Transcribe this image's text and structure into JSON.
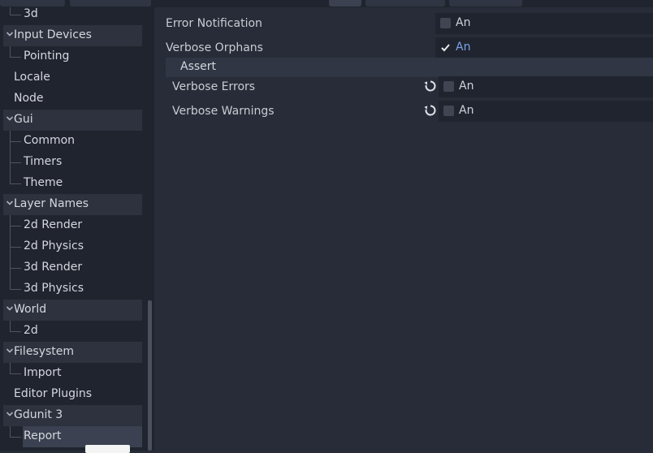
{
  "tree": {
    "items": [
      {
        "label": "3d",
        "kind": "child"
      },
      {
        "label": "Input Devices",
        "kind": "section"
      },
      {
        "label": "Pointing",
        "kind": "child"
      },
      {
        "label": "Locale",
        "kind": "plain"
      },
      {
        "label": "Node",
        "kind": "plain"
      },
      {
        "label": "Gui",
        "kind": "section"
      },
      {
        "label": "Common",
        "kind": "child"
      },
      {
        "label": "Timers",
        "kind": "child"
      },
      {
        "label": "Theme",
        "kind": "child"
      },
      {
        "label": "Layer Names",
        "kind": "section"
      },
      {
        "label": "2d Render",
        "kind": "child"
      },
      {
        "label": "2d Physics",
        "kind": "child"
      },
      {
        "label": "3d Render",
        "kind": "child"
      },
      {
        "label": "3d Physics",
        "kind": "child"
      },
      {
        "label": "World",
        "kind": "section"
      },
      {
        "label": "2d",
        "kind": "child"
      },
      {
        "label": "Filesystem",
        "kind": "section"
      },
      {
        "label": "Import",
        "kind": "child"
      },
      {
        "label": "Editor Plugins",
        "kind": "plain"
      },
      {
        "label": "Gdunit 3",
        "kind": "section"
      },
      {
        "label": "Report",
        "kind": "child",
        "selected": true
      }
    ],
    "arrow_icon": "chevron-down-icon"
  },
  "properties": {
    "error_notification": {
      "label": "Error Notification",
      "value": "An",
      "checked": false
    },
    "verbose_orphans": {
      "label": "Verbose Orphans",
      "value": "An",
      "checked": true
    },
    "assert_section": {
      "label": "Assert"
    },
    "verbose_errors": {
      "label": "Verbose Errors",
      "value": "An",
      "checked": false
    },
    "verbose_warnings": {
      "label": "Verbose Warnings",
      "value": "An",
      "checked": false
    }
  },
  "colors": {
    "accent": "#7aa3e5",
    "background": "#272c38",
    "tree_background": "#20242e",
    "section_row": "#2d323e"
  }
}
